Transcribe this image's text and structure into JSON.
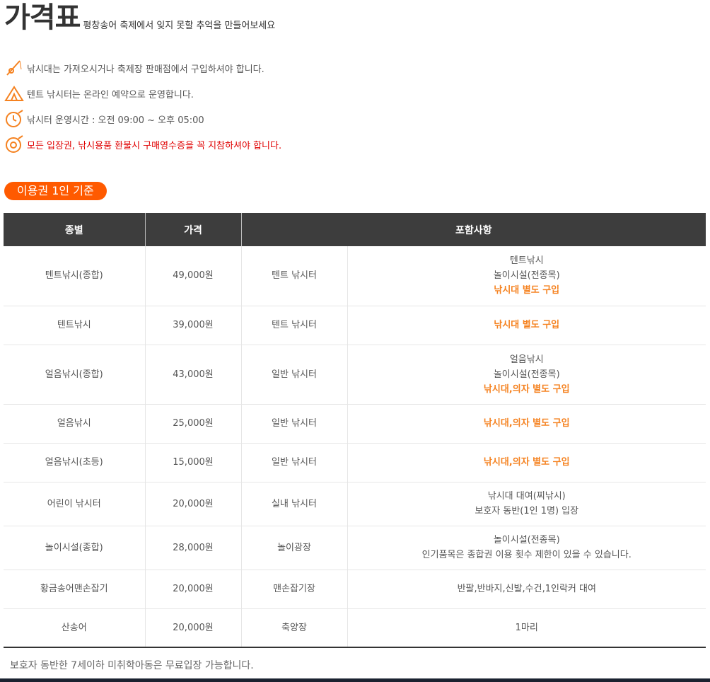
{
  "header": {
    "title": "가격표",
    "subtitle": "평창송어 축제에서 잊지 못할 추억을 만들어보세요"
  },
  "notices": [
    {
      "icon": "fishing-rod-icon",
      "text": "낚시대는 가져오시거나 축제장 판매점에서 구입하셔야 합니다."
    },
    {
      "icon": "tent-icon",
      "text": "텐트 낚시터는 온라인 예약으로 운영합니다."
    },
    {
      "icon": "clock-icon",
      "text": "낚시터 운영시간 : 오전 09:00 ~ 오후 05:00"
    },
    {
      "icon": "receipt-icon",
      "text": "모든 입장권, 낚시용품 환불시 구매영수증을 꼭 지참하셔야 합니다."
    }
  ],
  "badge": "이용권 1인 기준",
  "table": {
    "headers": [
      "종별",
      "가격",
      "포함사항"
    ],
    "rows": [
      {
        "type": "텐트낚시(종합)",
        "price": "49,000원",
        "place": "텐트 낚시터",
        "lines": [
          "텐트낚시",
          "놀이시설(전종목)"
        ],
        "note": "낚시대 별도 구입"
      },
      {
        "type": "텐트낚시",
        "price": "39,000원",
        "place": "텐트 낚시터",
        "lines": [],
        "note": "낚시대 별도 구입"
      },
      {
        "type": "얼음낚시(종합)",
        "price": "43,000원",
        "place": "일반 낚시터",
        "lines": [
          "얼음낚시",
          "놀이시설(전종목)"
        ],
        "note": "낚시대,의자 별도 구입"
      },
      {
        "type": "얼음낚시",
        "price": "25,000원",
        "place": "일반 낚시터",
        "lines": [],
        "note": "낚시대,의자 별도 구입"
      },
      {
        "type": "얼음낚시(초등)",
        "price": "15,000원",
        "place": "일반 낚시터",
        "lines": [],
        "note": "낚시대,의자 별도 구입"
      },
      {
        "type": "어린이 낚시터",
        "price": "20,000원",
        "place": "실내 낚시터",
        "lines": [
          "낚시대 대여(찌낚시)",
          "보호자 동반(1인 1명) 입장"
        ],
        "note": ""
      },
      {
        "type": "놀이시설(종합)",
        "price": "28,000원",
        "place": "놀이광장",
        "lines": [
          "놀이시설(전종목)",
          "인기품목은 종합권 이용 횟수 제한이 있을 수 있습니다."
        ],
        "note": ""
      },
      {
        "type": "황금송어맨손잡기",
        "price": "20,000원",
        "place": "맨손잡기장",
        "lines": [
          "반팔,반바지,신발,수건,1인락커 대여"
        ],
        "note": ""
      },
      {
        "type": "산송어",
        "price": "20,000원",
        "place": "축양장",
        "lines": [
          "1마리"
        ],
        "note": ""
      }
    ]
  },
  "footnote": "보호자 동반한 7세이하 미취학아동은 무료입장 가능합니다.",
  "colors": {
    "accent": "#ff5a00",
    "note": "#f58220",
    "warning": "#e00000",
    "table_header": "#3d3d3d"
  }
}
